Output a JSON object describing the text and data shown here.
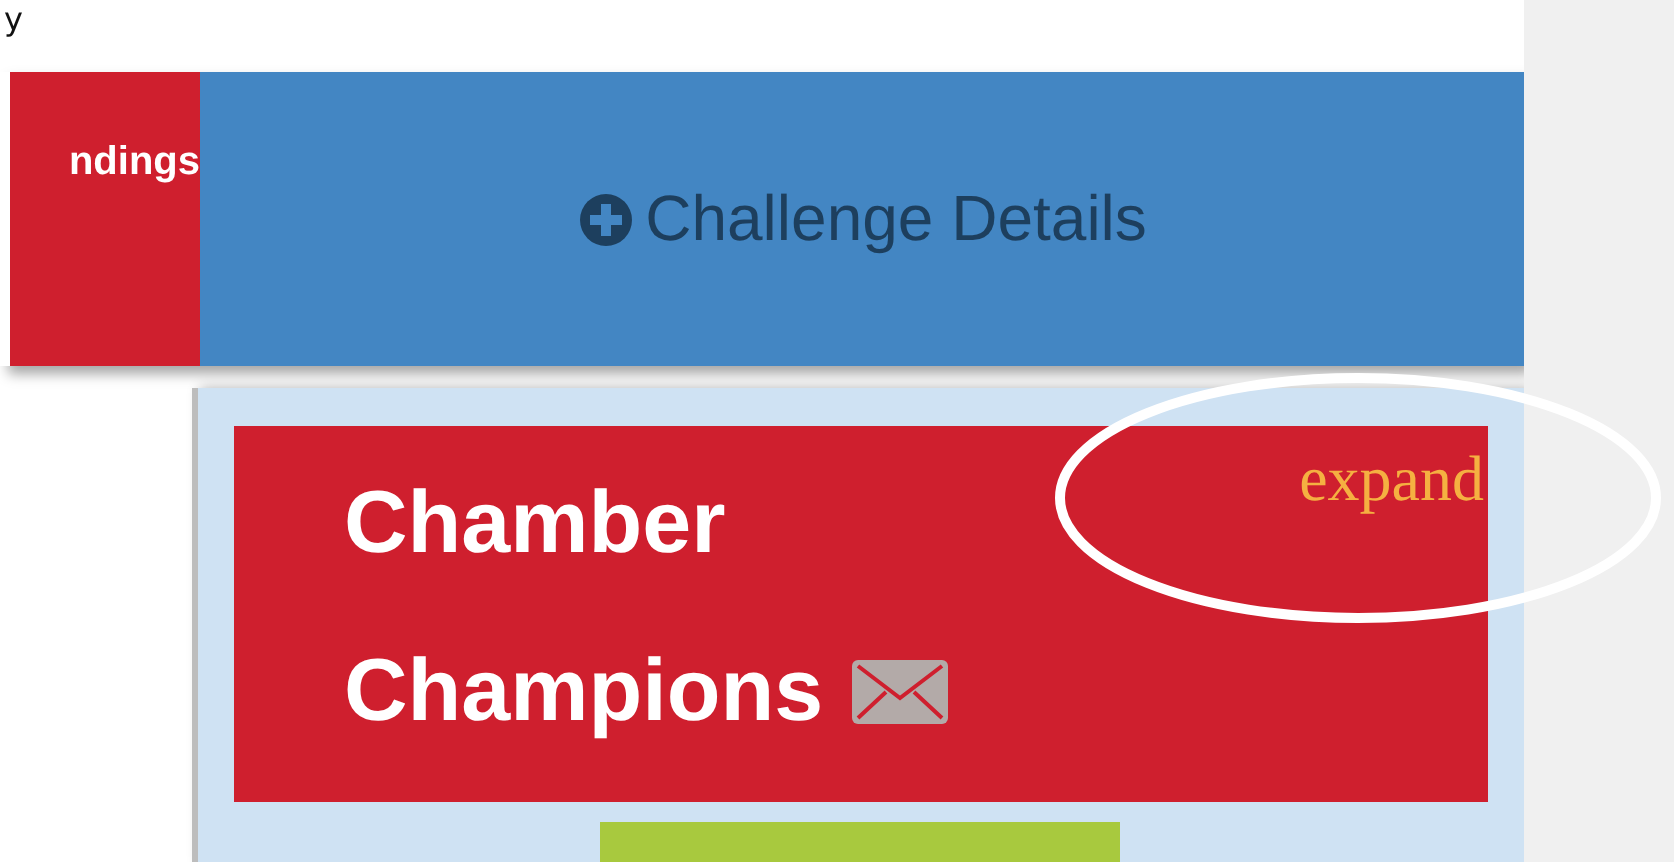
{
  "corner_text": "y",
  "tabs": [
    {
      "label": "ndings",
      "selected": false,
      "color": "#cf1f2e"
    },
    {
      "label": "Challenge Details",
      "selected": true,
      "color": "#4386c3"
    }
  ],
  "card": {
    "title_lines": [
      "Chamber",
      "Champions"
    ],
    "expand_link": "expand"
  }
}
